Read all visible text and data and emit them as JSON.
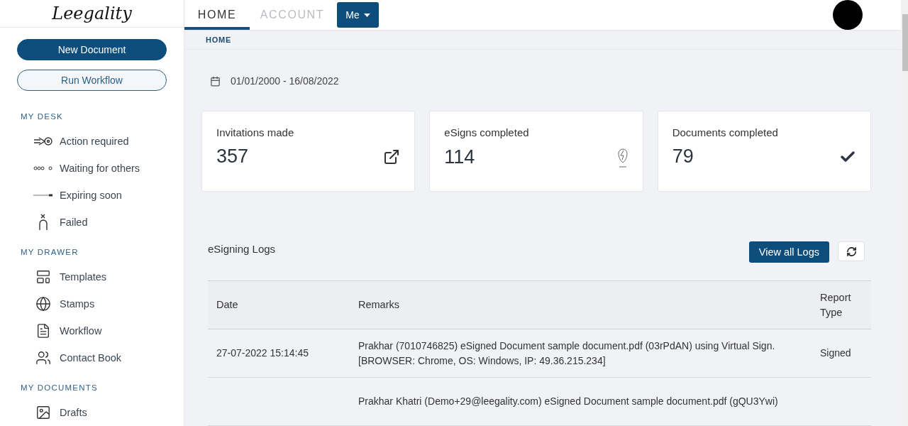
{
  "logo": {
    "text": "Leegality"
  },
  "nav": {
    "tabs": [
      {
        "label": "HOME",
        "selected": true
      },
      {
        "label": "ACCOUNT",
        "selected": false
      }
    ],
    "menu_button": "Me"
  },
  "sidebar": {
    "primary_button": "New Document",
    "secondary_button": "Run Workflow",
    "sections": [
      {
        "title": "MY DESK",
        "items": [
          {
            "label": "Action required",
            "kind": "action"
          },
          {
            "label": "Waiting for others",
            "kind": "waiting"
          },
          {
            "label": "Expiring soon",
            "kind": "expiring"
          },
          {
            "label": "Failed",
            "kind": "failed"
          }
        ]
      },
      {
        "title": "MY DRAWER",
        "items": [
          {
            "label": "Templates",
            "kind": "templates"
          },
          {
            "label": "Stamps",
            "kind": "stamps"
          },
          {
            "label": "Workflow",
            "kind": "workflow"
          },
          {
            "label": "Contact Book",
            "kind": "contacts"
          }
        ]
      },
      {
        "title": "MY DOCUMENTS",
        "items": [
          {
            "label": "Drafts",
            "kind": "drafts"
          }
        ]
      }
    ]
  },
  "breadcrumb": "HOME",
  "date_range": "01/01/2000 - 16/08/2022",
  "stats": [
    {
      "label": "Invitations made",
      "value": "357",
      "kind": "invitations"
    },
    {
      "label": "eSigns completed",
      "value": "114",
      "kind": "esigns"
    },
    {
      "label": "Documents completed",
      "value": "79",
      "kind": "documents"
    }
  ],
  "logs": {
    "title": "eSigning Logs",
    "view_button": "View all Logs",
    "table": {
      "columns": [
        "Date",
        "Remarks",
        "Report Type"
      ],
      "rows": [
        {
          "date": "27-07-2022 15:14:45",
          "remarks": "Prakhar (7010746825) eSigned Document sample document.pdf (03rPdAN) using Virtual Sign. [BROWSER: Chrome, OS: Windows, IP: 49.36.215.234]",
          "report_type": "Signed"
        },
        {
          "remarks": "Prakhar Khatri (Demo+29@leegality.com) eSigned Document sample document.pdf (gQU3Ywi)"
        }
      ]
    }
  }
}
